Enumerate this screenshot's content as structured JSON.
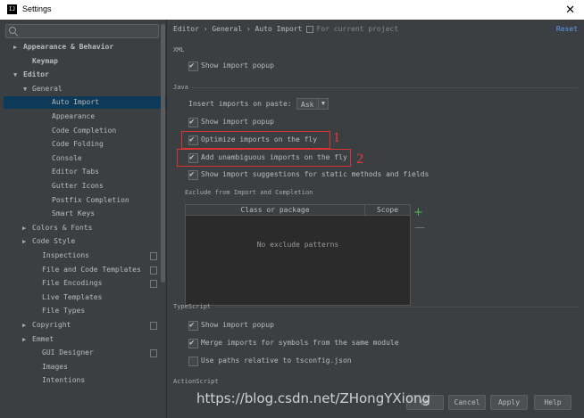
{
  "window": {
    "title": "Settings",
    "app_icon": "IJ"
  },
  "sidebar": {
    "search_placeholder": "",
    "items": [
      {
        "label": "Appearance & Behavior",
        "arrow": "▶",
        "bold": true
      },
      {
        "label": "Keymap",
        "arrow": "",
        "bold": true
      },
      {
        "label": "Editor",
        "arrow": "▼",
        "bold": true
      },
      {
        "label": "General",
        "arrow": "▼"
      },
      {
        "label": "Auto Import",
        "arrow": "",
        "selected": true
      },
      {
        "label": "Appearance",
        "arrow": ""
      },
      {
        "label": "Code Completion",
        "arrow": ""
      },
      {
        "label": "Code Folding",
        "arrow": ""
      },
      {
        "label": "Console",
        "arrow": ""
      },
      {
        "label": "Editor Tabs",
        "arrow": ""
      },
      {
        "label": "Gutter Icons",
        "arrow": ""
      },
      {
        "label": "Postfix Completion",
        "arrow": ""
      },
      {
        "label": "Smart Keys",
        "arrow": ""
      },
      {
        "label": "Colors & Fonts",
        "arrow": "▶"
      },
      {
        "label": "Code Style",
        "arrow": "▶"
      },
      {
        "label": "Inspections",
        "arrow": "",
        "mark": true
      },
      {
        "label": "File and Code Templates",
        "arrow": "",
        "mark": true
      },
      {
        "label": "File Encodings",
        "arrow": "",
        "mark": true
      },
      {
        "label": "Live Templates",
        "arrow": ""
      },
      {
        "label": "File Types",
        "arrow": ""
      },
      {
        "label": "Copyright",
        "arrow": "▶",
        "mark": true
      },
      {
        "label": "Emmet",
        "arrow": "▶"
      },
      {
        "label": "GUI Designer",
        "arrow": "",
        "mark": true
      },
      {
        "label": "Images",
        "arrow": ""
      },
      {
        "label": "Intentions",
        "arrow": ""
      }
    ]
  },
  "breadcrumb": {
    "path": "Editor › General › Auto Import",
    "scope": "For current project"
  },
  "reset_label": "Reset",
  "xml": {
    "header": "XML",
    "show_popup": "Show import popup"
  },
  "java": {
    "header": "Java",
    "insert_label": "Insert imports on paste:",
    "insert_value": "Ask",
    "show_popup": "Show import popup",
    "optimize": "Optimize imports on the fly",
    "add_unambiguous": "Add unambiguous imports on the fly",
    "show_suggestions": "Show import suggestions for static methods and fields",
    "exclude_header": "Exclude from Import and Completion",
    "table_col1": "Class or package",
    "table_col2": "Scope",
    "table_empty": "No exclude patterns",
    "add_symbol": "+",
    "remove_symbol": "—"
  },
  "annotations": {
    "mark1": "1",
    "mark2": "2"
  },
  "typescript": {
    "header": "TypeScript",
    "show_popup": "Show import popup",
    "merge": "Merge imports for symbols  from the same module",
    "relative": "Use paths relative to tsconfig.json"
  },
  "actionscript": {
    "header": "ActionScript"
  },
  "watermark": "https://blog.csdn.net/ZHongYXiong",
  "buttons": {
    "ok": "OK",
    "cancel": "Cancel",
    "apply": "Apply",
    "help": "Help"
  }
}
